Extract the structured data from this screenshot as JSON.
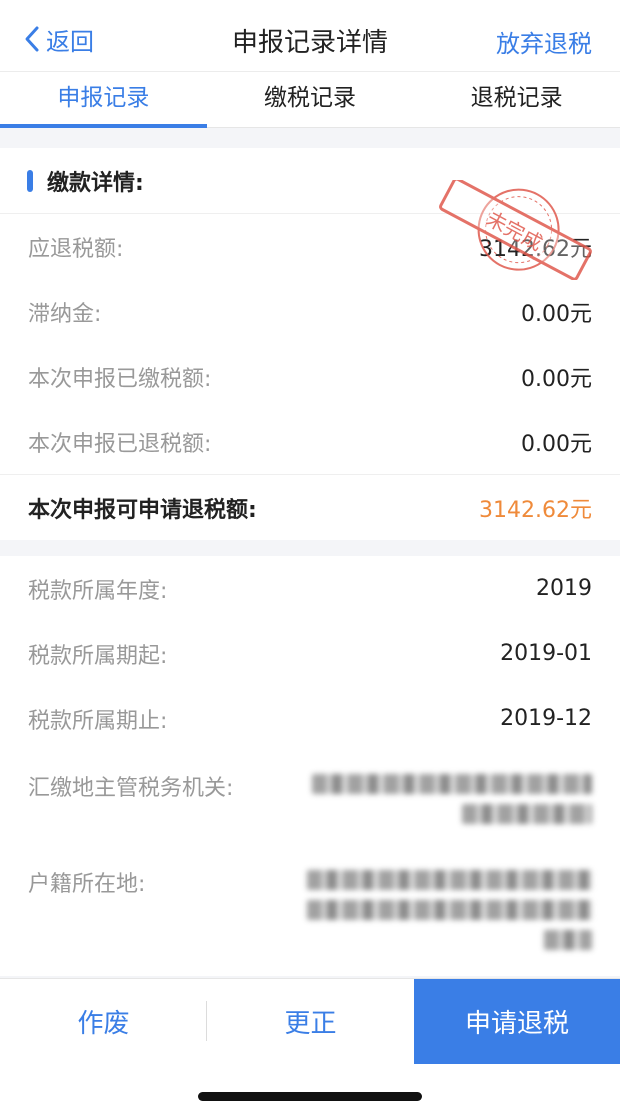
{
  "nav": {
    "back_label": "返回",
    "title": "申报记录详情",
    "right_action": "放弃退税"
  },
  "tabs": [
    {
      "label": "申报记录",
      "active": true
    },
    {
      "label": "缴税记录",
      "active": false
    },
    {
      "label": "退税记录",
      "active": false
    }
  ],
  "payment_details": {
    "section_title": "缴款详情:",
    "rows": [
      {
        "label": "应退税额:",
        "value": "3142.62元"
      },
      {
        "label": "滞纳金:",
        "value": "0.00元"
      },
      {
        "label": "本次申报已缴税额:",
        "value": "0.00元"
      },
      {
        "label": "本次申报已退税额:",
        "value": "0.00元"
      }
    ],
    "total": {
      "label": "本次申报可申请退税额:",
      "value": "3142.62元"
    },
    "stamp_text": "未完成"
  },
  "tax_info": {
    "rows": [
      {
        "label": "税款所属年度:",
        "value": "2019"
      },
      {
        "label": "税款所属期起:",
        "value": "2019-01"
      },
      {
        "label": "税款所属期止:",
        "value": "2019-12"
      }
    ],
    "authority_label": "汇缴地主管税务机关:",
    "household_label": "户籍所在地:"
  },
  "actions": {
    "void_label": "作废",
    "correct_label": "更正",
    "apply_label": "申请退税"
  },
  "colors": {
    "accent": "#3a7ee6",
    "highlight": "#ef8a3a",
    "stamp": "#e05a4e"
  },
  "icons": {
    "back": "chevron-left-icon"
  }
}
